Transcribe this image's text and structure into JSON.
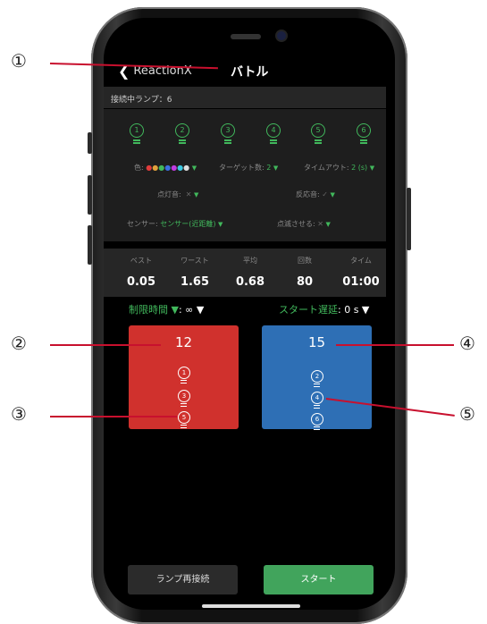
{
  "nav": {
    "back_label": "ReactionX",
    "title": "バトル"
  },
  "connected_label": "接続中ランプ：6",
  "lamps": [
    "1",
    "2",
    "3",
    "4",
    "5",
    "6"
  ],
  "options": {
    "color_label": "色:",
    "target_label": "ターゲット数:",
    "target_value": "2",
    "timeout_label": "タイムアウト:",
    "timeout_value": "2 (s)",
    "light_sound_label": "点灯音:",
    "reaction_sound_label": "反応音:",
    "sensor_label": "センサー:",
    "sensor_value": "センサー(近距離)",
    "blink_label": "点滅させる:",
    "dropdown_glyph": "▼",
    "off_glyph": "✕",
    "on_glyph": "✓"
  },
  "stats": {
    "headers": [
      "ベスト",
      "ワースト",
      "平均",
      "回数",
      "タイム"
    ],
    "values": [
      "0.05",
      "1.65",
      "0.68",
      "80",
      "01:00"
    ]
  },
  "time_limit": {
    "label": "制限時間 ▼",
    "value": ": ∞ ▼"
  },
  "start_delay": {
    "label": "スタート遅延",
    "value": ": 0 s ▼"
  },
  "players": [
    {
      "score": "12",
      "lamps": [
        "1",
        "3",
        "5"
      ],
      "color": "#d0312d"
    },
    {
      "score": "15",
      "lamps": [
        "2",
        "4",
        "6"
      ],
      "color": "#2e6fb5"
    }
  ],
  "buttons": {
    "reconnect": "ランプ再接続",
    "start": "スタート"
  },
  "callouts": [
    "①",
    "②",
    "③",
    "④",
    "⑤"
  ],
  "colors": {
    "accent_green": "#41b85c",
    "start_button": "#41a45c",
    "red_player": "#d0312d",
    "blue_player": "#2e6fb5"
  }
}
